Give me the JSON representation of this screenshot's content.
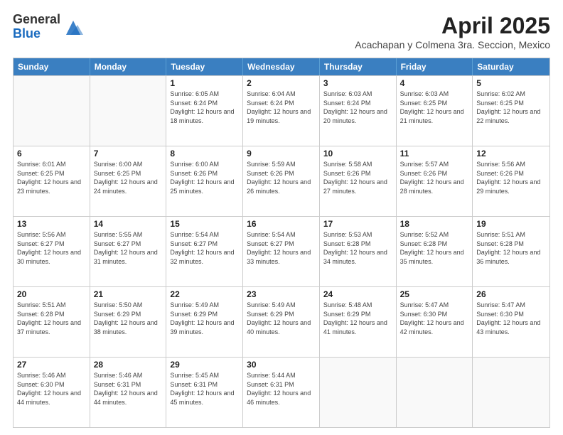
{
  "logo": {
    "general": "General",
    "blue": "Blue"
  },
  "title": "April 2025",
  "subtitle": "Acachapan y Colmena 3ra. Seccion, Mexico",
  "header_days": [
    "Sunday",
    "Monday",
    "Tuesday",
    "Wednesday",
    "Thursday",
    "Friday",
    "Saturday"
  ],
  "rows": [
    [
      {
        "day": "",
        "info": ""
      },
      {
        "day": "",
        "info": ""
      },
      {
        "day": "1",
        "info": "Sunrise: 6:05 AM\nSunset: 6:24 PM\nDaylight: 12 hours and 18 minutes."
      },
      {
        "day": "2",
        "info": "Sunrise: 6:04 AM\nSunset: 6:24 PM\nDaylight: 12 hours and 19 minutes."
      },
      {
        "day": "3",
        "info": "Sunrise: 6:03 AM\nSunset: 6:24 PM\nDaylight: 12 hours and 20 minutes."
      },
      {
        "day": "4",
        "info": "Sunrise: 6:03 AM\nSunset: 6:25 PM\nDaylight: 12 hours and 21 minutes."
      },
      {
        "day": "5",
        "info": "Sunrise: 6:02 AM\nSunset: 6:25 PM\nDaylight: 12 hours and 22 minutes."
      }
    ],
    [
      {
        "day": "6",
        "info": "Sunrise: 6:01 AM\nSunset: 6:25 PM\nDaylight: 12 hours and 23 minutes."
      },
      {
        "day": "7",
        "info": "Sunrise: 6:00 AM\nSunset: 6:25 PM\nDaylight: 12 hours and 24 minutes."
      },
      {
        "day": "8",
        "info": "Sunrise: 6:00 AM\nSunset: 6:26 PM\nDaylight: 12 hours and 25 minutes."
      },
      {
        "day": "9",
        "info": "Sunrise: 5:59 AM\nSunset: 6:26 PM\nDaylight: 12 hours and 26 minutes."
      },
      {
        "day": "10",
        "info": "Sunrise: 5:58 AM\nSunset: 6:26 PM\nDaylight: 12 hours and 27 minutes."
      },
      {
        "day": "11",
        "info": "Sunrise: 5:57 AM\nSunset: 6:26 PM\nDaylight: 12 hours and 28 minutes."
      },
      {
        "day": "12",
        "info": "Sunrise: 5:56 AM\nSunset: 6:26 PM\nDaylight: 12 hours and 29 minutes."
      }
    ],
    [
      {
        "day": "13",
        "info": "Sunrise: 5:56 AM\nSunset: 6:27 PM\nDaylight: 12 hours and 30 minutes."
      },
      {
        "day": "14",
        "info": "Sunrise: 5:55 AM\nSunset: 6:27 PM\nDaylight: 12 hours and 31 minutes."
      },
      {
        "day": "15",
        "info": "Sunrise: 5:54 AM\nSunset: 6:27 PM\nDaylight: 12 hours and 32 minutes."
      },
      {
        "day": "16",
        "info": "Sunrise: 5:54 AM\nSunset: 6:27 PM\nDaylight: 12 hours and 33 minutes."
      },
      {
        "day": "17",
        "info": "Sunrise: 5:53 AM\nSunset: 6:28 PM\nDaylight: 12 hours and 34 minutes."
      },
      {
        "day": "18",
        "info": "Sunrise: 5:52 AM\nSunset: 6:28 PM\nDaylight: 12 hours and 35 minutes."
      },
      {
        "day": "19",
        "info": "Sunrise: 5:51 AM\nSunset: 6:28 PM\nDaylight: 12 hours and 36 minutes."
      }
    ],
    [
      {
        "day": "20",
        "info": "Sunrise: 5:51 AM\nSunset: 6:28 PM\nDaylight: 12 hours and 37 minutes."
      },
      {
        "day": "21",
        "info": "Sunrise: 5:50 AM\nSunset: 6:29 PM\nDaylight: 12 hours and 38 minutes."
      },
      {
        "day": "22",
        "info": "Sunrise: 5:49 AM\nSunset: 6:29 PM\nDaylight: 12 hours and 39 minutes."
      },
      {
        "day": "23",
        "info": "Sunrise: 5:49 AM\nSunset: 6:29 PM\nDaylight: 12 hours and 40 minutes."
      },
      {
        "day": "24",
        "info": "Sunrise: 5:48 AM\nSunset: 6:29 PM\nDaylight: 12 hours and 41 minutes."
      },
      {
        "day": "25",
        "info": "Sunrise: 5:47 AM\nSunset: 6:30 PM\nDaylight: 12 hours and 42 minutes."
      },
      {
        "day": "26",
        "info": "Sunrise: 5:47 AM\nSunset: 6:30 PM\nDaylight: 12 hours and 43 minutes."
      }
    ],
    [
      {
        "day": "27",
        "info": "Sunrise: 5:46 AM\nSunset: 6:30 PM\nDaylight: 12 hours and 44 minutes."
      },
      {
        "day": "28",
        "info": "Sunrise: 5:46 AM\nSunset: 6:31 PM\nDaylight: 12 hours and 44 minutes."
      },
      {
        "day": "29",
        "info": "Sunrise: 5:45 AM\nSunset: 6:31 PM\nDaylight: 12 hours and 45 minutes."
      },
      {
        "day": "30",
        "info": "Sunrise: 5:44 AM\nSunset: 6:31 PM\nDaylight: 12 hours and 46 minutes."
      },
      {
        "day": "",
        "info": ""
      },
      {
        "day": "",
        "info": ""
      },
      {
        "day": "",
        "info": ""
      }
    ]
  ]
}
